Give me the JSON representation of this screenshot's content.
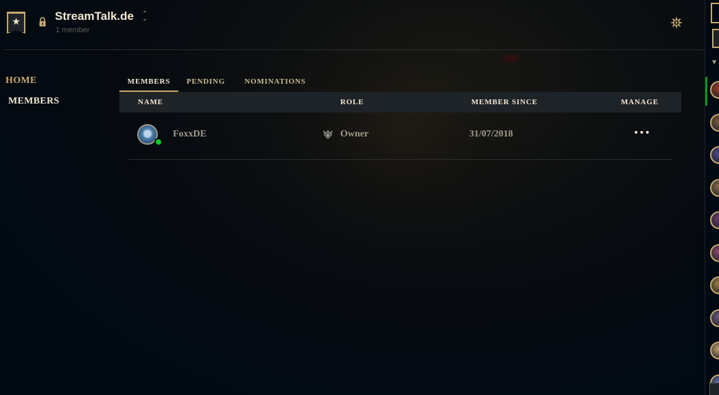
{
  "header": {
    "club_icon": "star-banner-icon",
    "lock_icon": "lock-icon",
    "club_name": "StreamTalk.de",
    "member_count": "1 member",
    "settings_icon": "gear-icon"
  },
  "nav": {
    "home_label": "HOME",
    "members_label": "MEMBERS"
  },
  "tabs": [
    {
      "label": "MEMBERS",
      "active": true
    },
    {
      "label": "PENDING",
      "active": false
    },
    {
      "label": "NOMINATIONS",
      "active": false
    }
  ],
  "table": {
    "columns": [
      "NAME",
      "ROLE",
      "MEMBER SINCE",
      "MANAGE"
    ],
    "rows": [
      {
        "name": "FoxxDE",
        "status": "online",
        "role": "Owner",
        "role_icon": "crest-icon",
        "member_since": "31/07/2018",
        "manage": "•••"
      }
    ]
  },
  "colors": {
    "gold": "#c8aa6e",
    "text_light": "#f0e6d2",
    "text_muted": "#a09b8c",
    "online": "#0acb28",
    "background": "#010a13",
    "table_header_bg": "#1e2328"
  },
  "rail": {
    "avatar_colors": [
      "#9a3a2a",
      "#7a5a3a",
      "#4a4a8a",
      "#8a6a4a",
      "#6a3a6a",
      "#8a4a6a",
      "#a08040",
      "#6a5a7a",
      "#c0a070",
      "#5a6aa0"
    ]
  }
}
